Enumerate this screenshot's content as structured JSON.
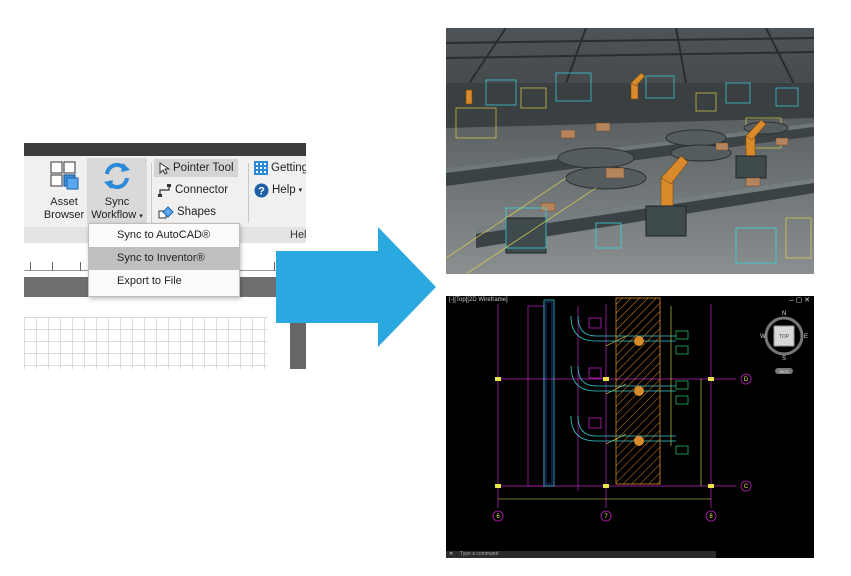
{
  "ribbon": {
    "asset_browser_label_1": "Asset",
    "asset_browser_label_2": "Browser",
    "sync_label_1": "Sync",
    "sync_label_2": "Workflow",
    "sync_caret": "▾",
    "pointer_tool": "Pointer Tool",
    "connector": "Connector",
    "shapes": "Shapes",
    "getting": "Getting",
    "help": "Help",
    "help_caret": "▾",
    "panel_label": "Hel"
  },
  "dropdown": {
    "items": [
      {
        "label": "Sync to AutoCAD®",
        "highlighted": false
      },
      {
        "label": "Sync to Inventor®",
        "highlighted": true
      },
      {
        "label": "Export to File",
        "highlighted": false
      }
    ]
  },
  "cad": {
    "viewport_label": "[-][Top][2D Wireframe]",
    "window_controls": "‒ ▢ ✕",
    "command_placeholder": "Type a command",
    "viewcube": {
      "top": "TOP",
      "n": "N",
      "s": "S",
      "e": "E",
      "w": "W",
      "wcs": "WCS"
    },
    "gridlines": {
      "col_6": "6",
      "col_7": "7",
      "col_8": "8",
      "row_d": "D",
      "row_c": "C"
    }
  },
  "colors": {
    "arrow": "#2aa8e0",
    "cad_background": "#000000",
    "cad_magenta": "#c020c0",
    "cad_yellow": "#e6e64a",
    "cad_cyan": "#36c9d4",
    "cad_orange": "#d98b2b"
  }
}
